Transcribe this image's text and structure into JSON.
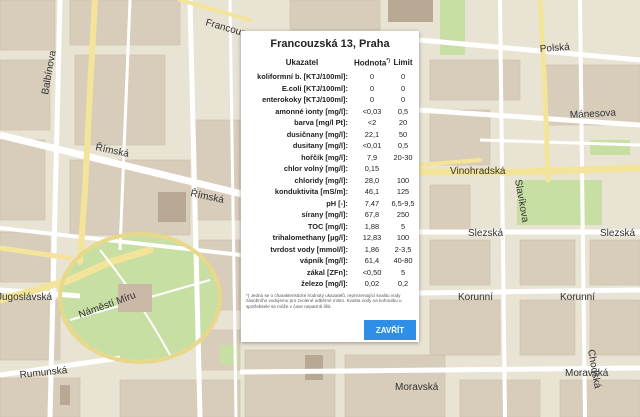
{
  "map": {
    "streets": {
      "francouzska": "Francouzská",
      "polska": "Polská",
      "manesova": "Mánesova",
      "rimska1": "Římská",
      "rimska2": "Římská",
      "vinohradska": "Vinohradská",
      "slezska1": "Slezská",
      "slezska2": "Slezská",
      "korunni1": "Korunní",
      "korunni2": "Korunní",
      "moravska1": "Moravská",
      "moravska2": "Moravská",
      "namesti_miru": "Náměstí Míru",
      "rumunska": "Rumunská",
      "jugoslavska": "Jugoslávská",
      "balbinova": "Balbínova",
      "slavikova": "Slavíkova",
      "chodska": "Chodská"
    }
  },
  "modal": {
    "title": "Francouzská 13, Praha",
    "headers": {
      "name": "Ukazatel",
      "value": "Hodnota",
      "value_sup": "*)",
      "limit": "Limit"
    },
    "rows": [
      {
        "name": "koliformní b. [KTJ/100ml]:",
        "value": "0",
        "limit": "0"
      },
      {
        "name": "E.coli [KTJ/100ml]:",
        "value": "0",
        "limit": "0"
      },
      {
        "name": "enterokoky [KTJ/100ml]:",
        "value": "0",
        "limit": "0"
      },
      {
        "name": "amonné ionty [mg/l]:",
        "value": "<0,03",
        "limit": "0,5"
      },
      {
        "name": "barva [mg/l Pt]:",
        "value": "<2",
        "limit": "20"
      },
      {
        "name": "dusičnany [mg/l]:",
        "value": "22,1",
        "limit": "50"
      },
      {
        "name": "dusitany [mg/l]:",
        "value": "<0,01",
        "limit": "0,5"
      },
      {
        "name": "hořčík [mg/l]:",
        "value": "7,9",
        "limit": "20-30"
      },
      {
        "name": "chlor volný [mg/l]:",
        "value": "0,15",
        "limit": ""
      },
      {
        "name": "chloridy [mg/l]:",
        "value": "28,0",
        "limit": "100"
      },
      {
        "name": "konduktivita [mS/m]:",
        "value": "46,1",
        "limit": "125"
      },
      {
        "name": "pH [-]:",
        "value": "7,47",
        "limit": "6,5-9,5"
      },
      {
        "name": "sírany [mg/l]:",
        "value": "67,8",
        "limit": "250"
      },
      {
        "name": "TOC [mg/l]:",
        "value": "1,88",
        "limit": "5"
      },
      {
        "name": "trihalomethany [µg/l]:",
        "value": "12,83",
        "limit": "100"
      },
      {
        "name": "tvrdost vody [mmol/l]:",
        "value": "1,86",
        "limit": "2-3,5"
      },
      {
        "name": "vápník [mg/l]:",
        "value": "61,4",
        "limit": "40-80"
      },
      {
        "name": "zákal [ZFn]:",
        "value": "<0,50",
        "limit": "5"
      },
      {
        "name": "železo [mg/l]:",
        "value": "0,02",
        "limit": "0,2"
      }
    ],
    "footnote": "*) Jedná se o charakteristické hodnoty ukazatelů, reprezentující kvalitu vody zásobního vodojemu pro zvolené odběrné místo. Kvalita vody na kohoutku u spotřebitele se může v čase nepatrně lišit.",
    "close_label": "ZAVŘÍT"
  },
  "colors": {
    "map_background": "#e9e3d3",
    "street": "#ffffff",
    "main_road": "#f4e49a",
    "park": "#c8dfa4",
    "building": "#c9b9a6",
    "button": "#2f8fe6"
  }
}
